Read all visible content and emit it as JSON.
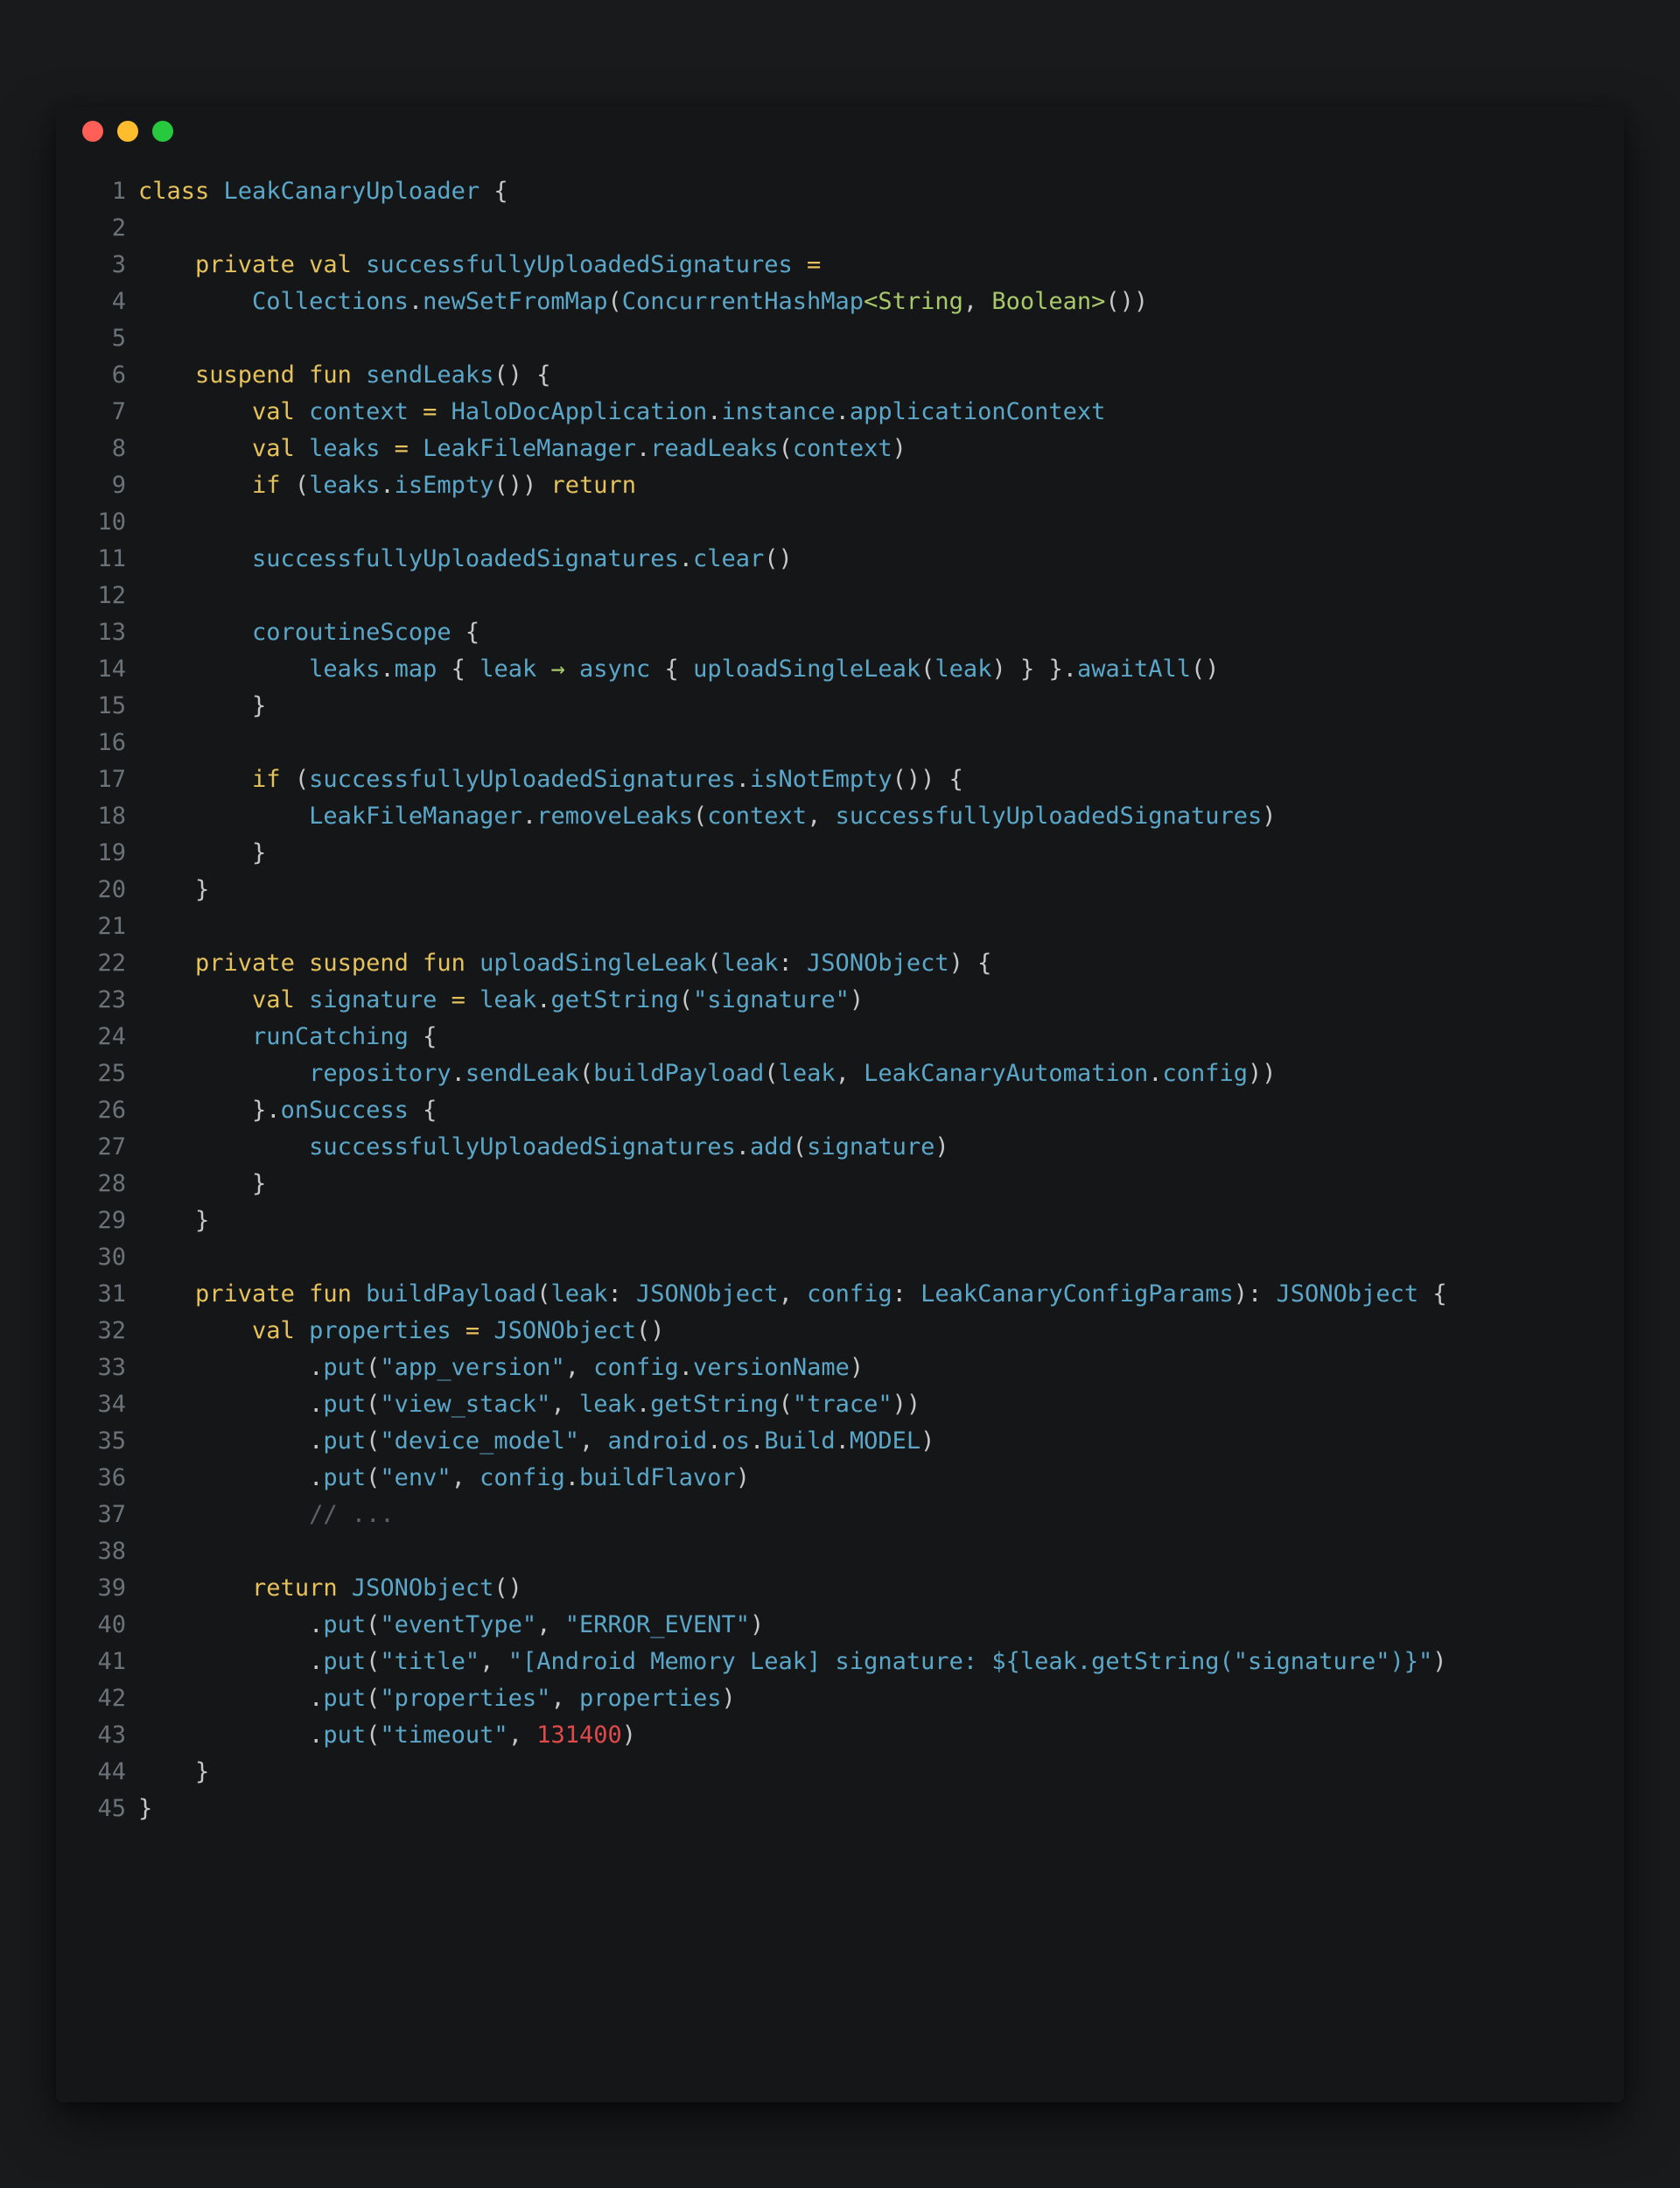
{
  "window": {
    "controls": [
      "close",
      "minimize",
      "maximize"
    ]
  },
  "colors": {
    "keyword": "#e6c25c",
    "identifier": "#5ba7c9",
    "punctuation": "#c5c8c6",
    "type_param": "#a8c96a",
    "number": "#e04a4a",
    "comment": "#5d6266",
    "line_number": "#6b7278",
    "background": "#151618"
  },
  "code": {
    "lines": [
      {
        "n": "1",
        "t": [
          [
            "kw",
            "class "
          ],
          [
            "id",
            "LeakCanaryUploader"
          ],
          [
            "p",
            " {"
          ]
        ]
      },
      {
        "n": "2",
        "t": []
      },
      {
        "n": "3",
        "t": [
          [
            "p",
            "    "
          ],
          [
            "kw",
            "private val "
          ],
          [
            "id",
            "successfullyUploadedSignatures"
          ],
          [
            "kw",
            " ="
          ]
        ]
      },
      {
        "n": "4",
        "t": [
          [
            "p",
            "        "
          ],
          [
            "id",
            "Collections"
          ],
          [
            "p",
            "."
          ],
          [
            "id",
            "newSetFromMap"
          ],
          [
            "p",
            "("
          ],
          [
            "id",
            "ConcurrentHashMap"
          ],
          [
            "ty",
            "<String"
          ],
          [
            "p",
            ", "
          ],
          [
            "ty",
            "Boolean>"
          ],
          [
            "p",
            "())"
          ]
        ]
      },
      {
        "n": "5",
        "t": []
      },
      {
        "n": "6",
        "t": [
          [
            "p",
            "    "
          ],
          [
            "kw",
            "suspend fun "
          ],
          [
            "id",
            "sendLeaks"
          ],
          [
            "p",
            "() {"
          ]
        ]
      },
      {
        "n": "7",
        "t": [
          [
            "p",
            "        "
          ],
          [
            "kw",
            "val "
          ],
          [
            "id",
            "context"
          ],
          [
            "kw",
            " = "
          ],
          [
            "id",
            "HaloDocApplication"
          ],
          [
            "p",
            "."
          ],
          [
            "id",
            "instance"
          ],
          [
            "p",
            "."
          ],
          [
            "id",
            "applicationContext"
          ]
        ]
      },
      {
        "n": "8",
        "t": [
          [
            "p",
            "        "
          ],
          [
            "kw",
            "val "
          ],
          [
            "id",
            "leaks"
          ],
          [
            "kw",
            " = "
          ],
          [
            "id",
            "LeakFileManager"
          ],
          [
            "p",
            "."
          ],
          [
            "id",
            "readLeaks"
          ],
          [
            "p",
            "("
          ],
          [
            "id",
            "context"
          ],
          [
            "p",
            ")"
          ]
        ]
      },
      {
        "n": "9",
        "t": [
          [
            "p",
            "        "
          ],
          [
            "kw",
            "if "
          ],
          [
            "p",
            "("
          ],
          [
            "id",
            "leaks"
          ],
          [
            "p",
            "."
          ],
          [
            "id",
            "isEmpty"
          ],
          [
            "p",
            "()) "
          ],
          [
            "kw",
            "return"
          ]
        ]
      },
      {
        "n": "10",
        "t": []
      },
      {
        "n": "11",
        "t": [
          [
            "p",
            "        "
          ],
          [
            "id",
            "successfullyUploadedSignatures"
          ],
          [
            "p",
            "."
          ],
          [
            "id",
            "clear"
          ],
          [
            "p",
            "()"
          ]
        ]
      },
      {
        "n": "12",
        "t": []
      },
      {
        "n": "13",
        "t": [
          [
            "p",
            "        "
          ],
          [
            "id",
            "coroutineScope"
          ],
          [
            "p",
            " {"
          ]
        ]
      },
      {
        "n": "14",
        "t": [
          [
            "p",
            "            "
          ],
          [
            "id",
            "leaks"
          ],
          [
            "p",
            "."
          ],
          [
            "id",
            "map"
          ],
          [
            "p",
            " { "
          ],
          [
            "id",
            "leak"
          ],
          [
            "op",
            " → "
          ],
          [
            "id",
            "async"
          ],
          [
            "p",
            " { "
          ],
          [
            "id",
            "uploadSingleLeak"
          ],
          [
            "p",
            "("
          ],
          [
            "id",
            "leak"
          ],
          [
            "p",
            ") } }."
          ],
          [
            "id",
            "awaitAll"
          ],
          [
            "p",
            "()"
          ]
        ]
      },
      {
        "n": "15",
        "t": [
          [
            "p",
            "        }"
          ]
        ]
      },
      {
        "n": "16",
        "t": []
      },
      {
        "n": "17",
        "t": [
          [
            "p",
            "        "
          ],
          [
            "kw",
            "if "
          ],
          [
            "p",
            "("
          ],
          [
            "id",
            "successfullyUploadedSignatures"
          ],
          [
            "p",
            "."
          ],
          [
            "id",
            "isNotEmpty"
          ],
          [
            "p",
            "()) {"
          ]
        ]
      },
      {
        "n": "18",
        "t": [
          [
            "p",
            "            "
          ],
          [
            "id",
            "LeakFileManager"
          ],
          [
            "p",
            "."
          ],
          [
            "id",
            "removeLeaks"
          ],
          [
            "p",
            "("
          ],
          [
            "id",
            "context"
          ],
          [
            "p",
            ", "
          ],
          [
            "id",
            "successfullyUploadedSignatures"
          ],
          [
            "p",
            ")"
          ]
        ]
      },
      {
        "n": "19",
        "t": [
          [
            "p",
            "        }"
          ]
        ]
      },
      {
        "n": "20",
        "t": [
          [
            "p",
            "    }"
          ]
        ]
      },
      {
        "n": "21",
        "t": []
      },
      {
        "n": "22",
        "t": [
          [
            "p",
            "    "
          ],
          [
            "kw",
            "private suspend fun "
          ],
          [
            "id",
            "uploadSingleLeak"
          ],
          [
            "p",
            "("
          ],
          [
            "id",
            "leak"
          ],
          [
            "p",
            ": "
          ],
          [
            "id",
            "JSONObject"
          ],
          [
            "p",
            ") {"
          ]
        ]
      },
      {
        "n": "23",
        "t": [
          [
            "p",
            "        "
          ],
          [
            "kw",
            "val "
          ],
          [
            "id",
            "signature"
          ],
          [
            "kw",
            " = "
          ],
          [
            "id",
            "leak"
          ],
          [
            "p",
            "."
          ],
          [
            "id",
            "getString"
          ],
          [
            "p",
            "("
          ],
          [
            "id",
            "\"signature\""
          ],
          [
            "p",
            ")"
          ]
        ]
      },
      {
        "n": "24",
        "t": [
          [
            "p",
            "        "
          ],
          [
            "id",
            "runCatching"
          ],
          [
            "p",
            " {"
          ]
        ]
      },
      {
        "n": "25",
        "t": [
          [
            "p",
            "            "
          ],
          [
            "id",
            "repository"
          ],
          [
            "p",
            "."
          ],
          [
            "id",
            "sendLeak"
          ],
          [
            "p",
            "("
          ],
          [
            "id",
            "buildPayload"
          ],
          [
            "p",
            "("
          ],
          [
            "id",
            "leak"
          ],
          [
            "p",
            ", "
          ],
          [
            "id",
            "LeakCanaryAutomation"
          ],
          [
            "p",
            "."
          ],
          [
            "id",
            "config"
          ],
          [
            "p",
            "))"
          ]
        ]
      },
      {
        "n": "26",
        "t": [
          [
            "p",
            "        }."
          ],
          [
            "id",
            "onSuccess"
          ],
          [
            "p",
            " {"
          ]
        ]
      },
      {
        "n": "27",
        "t": [
          [
            "p",
            "            "
          ],
          [
            "id",
            "successfullyUploadedSignatures"
          ],
          [
            "p",
            "."
          ],
          [
            "id",
            "add"
          ],
          [
            "p",
            "("
          ],
          [
            "id",
            "signature"
          ],
          [
            "p",
            ")"
          ]
        ]
      },
      {
        "n": "28",
        "t": [
          [
            "p",
            "        }"
          ]
        ]
      },
      {
        "n": "29",
        "t": [
          [
            "p",
            "    }"
          ]
        ]
      },
      {
        "n": "30",
        "t": []
      },
      {
        "n": "31",
        "t": [
          [
            "p",
            "    "
          ],
          [
            "kw",
            "private fun "
          ],
          [
            "id",
            "buildPayload"
          ],
          [
            "p",
            "("
          ],
          [
            "id",
            "leak"
          ],
          [
            "p",
            ": "
          ],
          [
            "id",
            "JSONObject"
          ],
          [
            "p",
            ", "
          ],
          [
            "id",
            "config"
          ],
          [
            "p",
            ": "
          ],
          [
            "id",
            "LeakCanaryConfigParams"
          ],
          [
            "p",
            "): "
          ],
          [
            "id",
            "JSONObject"
          ],
          [
            "p",
            " {"
          ]
        ]
      },
      {
        "n": "32",
        "t": [
          [
            "p",
            "        "
          ],
          [
            "kw",
            "val "
          ],
          [
            "id",
            "properties"
          ],
          [
            "kw",
            " = "
          ],
          [
            "id",
            "JSONObject"
          ],
          [
            "p",
            "()"
          ]
        ]
      },
      {
        "n": "33",
        "t": [
          [
            "p",
            "            ."
          ],
          [
            "id",
            "put"
          ],
          [
            "p",
            "("
          ],
          [
            "id",
            "\"app_version\""
          ],
          [
            "p",
            ", "
          ],
          [
            "id",
            "config"
          ],
          [
            "p",
            "."
          ],
          [
            "id",
            "versionName"
          ],
          [
            "p",
            ")"
          ]
        ]
      },
      {
        "n": "34",
        "t": [
          [
            "p",
            "            ."
          ],
          [
            "id",
            "put"
          ],
          [
            "p",
            "("
          ],
          [
            "id",
            "\"view_stack\""
          ],
          [
            "p",
            ", "
          ],
          [
            "id",
            "leak"
          ],
          [
            "p",
            "."
          ],
          [
            "id",
            "getString"
          ],
          [
            "p",
            "("
          ],
          [
            "id",
            "\"trace\""
          ],
          [
            "p",
            "))"
          ]
        ]
      },
      {
        "n": "35",
        "t": [
          [
            "p",
            "            ."
          ],
          [
            "id",
            "put"
          ],
          [
            "p",
            "("
          ],
          [
            "id",
            "\"device_model\""
          ],
          [
            "p",
            ", "
          ],
          [
            "id",
            "android"
          ],
          [
            "p",
            "."
          ],
          [
            "id",
            "os"
          ],
          [
            "p",
            "."
          ],
          [
            "id",
            "Build"
          ],
          [
            "p",
            "."
          ],
          [
            "id",
            "MODEL"
          ],
          [
            "p",
            ")"
          ]
        ]
      },
      {
        "n": "36",
        "t": [
          [
            "p",
            "            ."
          ],
          [
            "id",
            "put"
          ],
          [
            "p",
            "("
          ],
          [
            "id",
            "\"env\""
          ],
          [
            "p",
            ", "
          ],
          [
            "id",
            "config"
          ],
          [
            "p",
            "."
          ],
          [
            "id",
            "buildFlavor"
          ],
          [
            "p",
            ")"
          ]
        ]
      },
      {
        "n": "37",
        "t": [
          [
            "p",
            "            "
          ],
          [
            "cm",
            "// ..."
          ]
        ]
      },
      {
        "n": "38",
        "t": []
      },
      {
        "n": "39",
        "t": [
          [
            "p",
            "        "
          ],
          [
            "kw",
            "return "
          ],
          [
            "id",
            "JSONObject"
          ],
          [
            "p",
            "()"
          ]
        ]
      },
      {
        "n": "40",
        "t": [
          [
            "p",
            "            ."
          ],
          [
            "id",
            "put"
          ],
          [
            "p",
            "("
          ],
          [
            "id",
            "\"eventType\""
          ],
          [
            "p",
            ", "
          ],
          [
            "id",
            "\"ERROR_EVENT\""
          ],
          [
            "p",
            ")"
          ]
        ]
      },
      {
        "n": "41",
        "t": [
          [
            "p",
            "            ."
          ],
          [
            "id",
            "put"
          ],
          [
            "p",
            "("
          ],
          [
            "id",
            "\"title\""
          ],
          [
            "p",
            ", "
          ],
          [
            "id",
            "\"[Android Memory Leak] signature: ${leak.getString(\"signature\")}\""
          ],
          [
            "p",
            ")"
          ]
        ]
      },
      {
        "n": "42",
        "t": [
          [
            "p",
            "            ."
          ],
          [
            "id",
            "put"
          ],
          [
            "p",
            "("
          ],
          [
            "id",
            "\"properties\""
          ],
          [
            "p",
            ", "
          ],
          [
            "id",
            "properties"
          ],
          [
            "p",
            ")"
          ]
        ]
      },
      {
        "n": "43",
        "t": [
          [
            "p",
            "            ."
          ],
          [
            "id",
            "put"
          ],
          [
            "p",
            "("
          ],
          [
            "id",
            "\"timeout\""
          ],
          [
            "p",
            ", "
          ],
          [
            "num",
            "131400"
          ],
          [
            "p",
            ")"
          ]
        ]
      },
      {
        "n": "44",
        "t": [
          [
            "p",
            "    }"
          ]
        ]
      },
      {
        "n": "45",
        "t": [
          [
            "p",
            "}"
          ]
        ]
      }
    ]
  }
}
